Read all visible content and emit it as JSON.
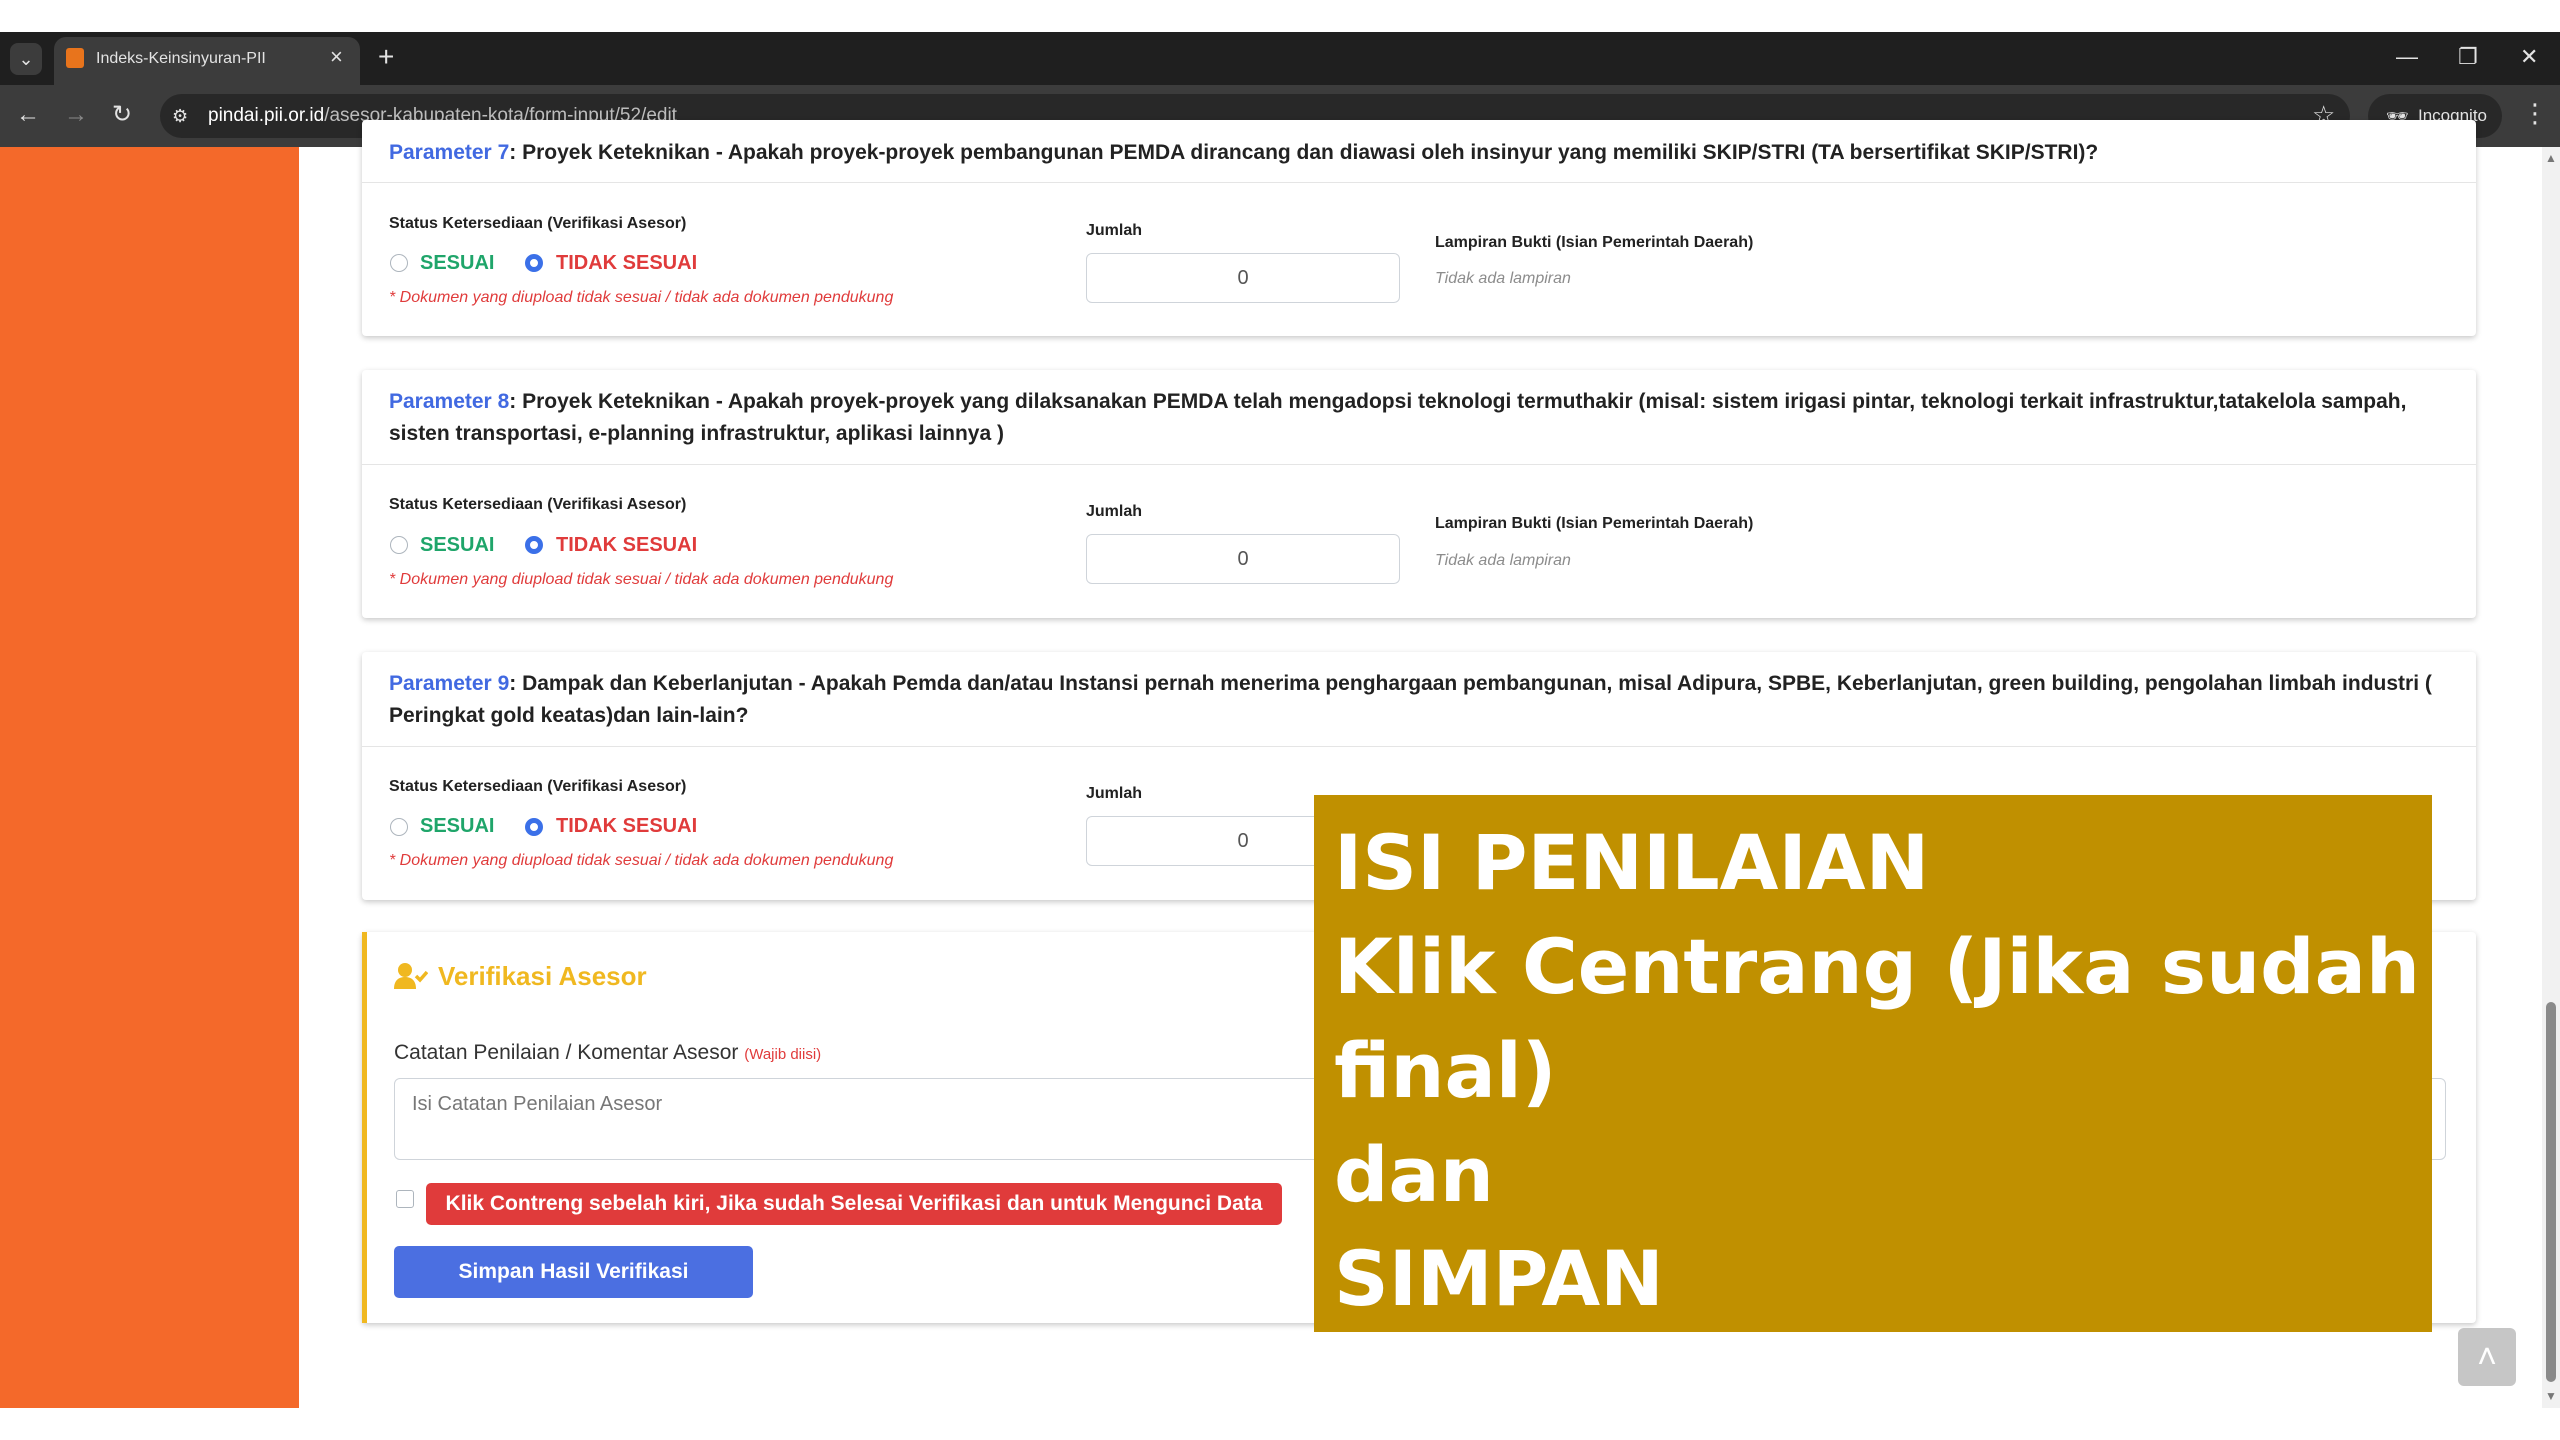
{
  "browser": {
    "tab_title": "Indeks-Keinsinyuran-PII",
    "tab_close": "×",
    "new_tab": "+",
    "url_host": "pindai.pii.or.id",
    "url_path": "/asesor-kabupaten-kota/form-input/52/edit",
    "incognito_label": "Incognito",
    "icons": [
      "tab-list-icon",
      "favicon",
      "close-icon",
      "new-tab-icon",
      "minimize-icon",
      "restore-icon",
      "window-close-icon",
      "back-icon",
      "forward-icon",
      "reload-icon",
      "site-settings-icon",
      "bookmark-star-icon",
      "incognito-icon",
      "menu-kebab-icon"
    ]
  },
  "parameters": [
    {
      "label": "Parameter 7",
      "question": ": Proyek Keteknikan - Apakah proyek-proyek pembangunan PEMDA dirancang dan diawasi oleh insinyur yang memiliki SKIP/STRI (TA bersertifikat SKIP/STRI)?",
      "status_label": "Status Ketersediaan (Verifikasi Asesor)",
      "option_sesuai": "SESUAI",
      "option_tidak_sesuai": "TIDAK SESUAI",
      "selected": "TIDAK SESUAI",
      "note": "* Dokumen yang diupload tidak sesuai / tidak ada dokumen pendukung",
      "jumlah_label": "Jumlah",
      "jumlah_value": "0",
      "lampiran_label": "Lampiran Bukti (Isian Pemerintah Daerah)",
      "lampiran_value": "Tidak ada lampiran"
    },
    {
      "label": "Parameter 8",
      "question": ": Proyek Keteknikan - Apakah proyek-proyek yang dilaksanakan PEMDA telah mengadopsi teknologi termuthakir (misal: sistem irigasi pintar, teknologi terkait infrastruktur,tatakelola sampah, sisten transportasi, e-planning infrastruktur, aplikasi lainnya )",
      "status_label": "Status Ketersediaan (Verifikasi Asesor)",
      "option_sesuai": "SESUAI",
      "option_tidak_sesuai": "TIDAK SESUAI",
      "selected": "TIDAK SESUAI",
      "note": "* Dokumen yang diupload tidak sesuai / tidak ada dokumen pendukung",
      "jumlah_label": "Jumlah",
      "jumlah_value": "0",
      "lampiran_label": "Lampiran Bukti (Isian Pemerintah Daerah)",
      "lampiran_value": "Tidak ada lampiran"
    },
    {
      "label": "Parameter 9",
      "question": ": Dampak dan Keberlanjutan - Apakah Pemda dan/atau Instansi pernah menerima penghargaan pembangunan, misal Adipura, SPBE, Keberlanjutan, green building, pengolahan limbah industri ( Peringkat gold keatas)dan lain-lain?",
      "status_label": "Status Ketersediaan (Verifikasi Asesor)",
      "option_sesuai": "SESUAI",
      "option_tidak_sesuai": "TIDAK SESUAI",
      "selected": "TIDAK SESUAI",
      "note": "* Dokumen yang diupload tidak sesuai / tidak ada dokumen pendukung",
      "jumlah_label": "Jumlah",
      "jumlah_value": "0"
    }
  ],
  "verifikasi": {
    "title": "Verifikasi Asesor",
    "note_label": "Catatan Penilaian / Komentar Asesor",
    "note_required": "(Wajib diisi)",
    "note_placeholder": "Isi Catatan Penilaian Asesor",
    "checkbox_label": "Klik Contreng sebelah kiri, Jika sudah Selesai Verifikasi dan untuk Mengunci Data",
    "submit_label": "Simpan Hasil Verifikasi"
  },
  "overlay": {
    "text": "ISI PENILAIAN\nKlik Centrang (Jika sudah\nfinal)\ndan\nSIMPAN"
  },
  "back_to_top": "˄",
  "colors": {
    "sidebar": "#f4692a",
    "param_label": "#4169e1",
    "sesuai": "#1fa56a",
    "tidak_sesuai": "#e03b3b",
    "verif_accent": "#f0b820",
    "overlay_bg": "#c09000",
    "submit_button": "#4b6fe1"
  }
}
